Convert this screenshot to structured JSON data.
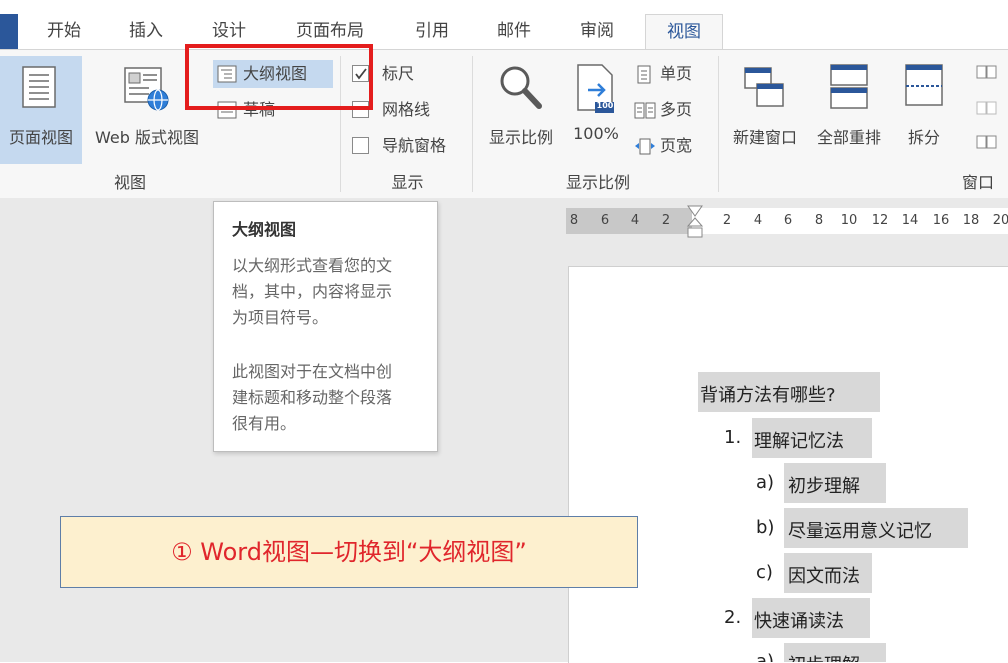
{
  "tabs": [
    "开始",
    "插入",
    "设计",
    "页面布局",
    "引用",
    "邮件",
    "审阅",
    "视图"
  ],
  "active_tab": "视图",
  "ribbon": {
    "views_group": {
      "label": "视图",
      "print_layout": "页面视图",
      "web_layout": "Web 版式视图",
      "outline": "大纲视图",
      "draft": "草稿"
    },
    "show_group": {
      "label": "显示",
      "ruler": {
        "label": "标尺",
        "checked": true
      },
      "gridlines": {
        "label": "网格线",
        "checked": false
      },
      "nav_pane": {
        "label": "导航窗格",
        "checked": false
      }
    },
    "zoom_group": {
      "label": "显示比例",
      "zoom": "显示比例",
      "hundred": "100%",
      "hundred_badge": "100",
      "one_page": "单页",
      "multi_page": "多页",
      "page_width": "页宽"
    },
    "window_group": {
      "label": "窗口",
      "new_window": "新建窗口",
      "arrange_all": "全部重排",
      "split": "拆分"
    }
  },
  "ruler_ticks": [
    "8",
    "6",
    "4",
    "2",
    "2",
    "4",
    "6",
    "8",
    "10",
    "12",
    "14",
    "16",
    "18",
    "20"
  ],
  "tooltip": {
    "title": "大纲视图",
    "lines": [
      "以大纲形式查看您的文",
      "档，其中，内容将显示",
      "为项目符号。",
      "此视图对于在文档中创",
      "建标题和移动整个段落",
      "很有用。"
    ]
  },
  "document": {
    "heading": "背诵方法有哪些?",
    "items": [
      {
        "num": "1.",
        "text": "理解记忆法"
      },
      {
        "num": "a)",
        "text": "初步理解"
      },
      {
        "num": "b)",
        "text": "尽量运用意义记忆"
      },
      {
        "num": "c)",
        "text": "因文而法"
      },
      {
        "num": "2.",
        "text": "快速诵读法"
      },
      {
        "num": "a)",
        "text": "初步理解"
      }
    ]
  },
  "callout": "① Word视图—切换到“大纲视图”",
  "colors": {
    "accent": "#2b579a",
    "highlight_box": "#e41d1d",
    "callout_bg": "#fdf0cf",
    "callout_text": "#e0262c"
  }
}
